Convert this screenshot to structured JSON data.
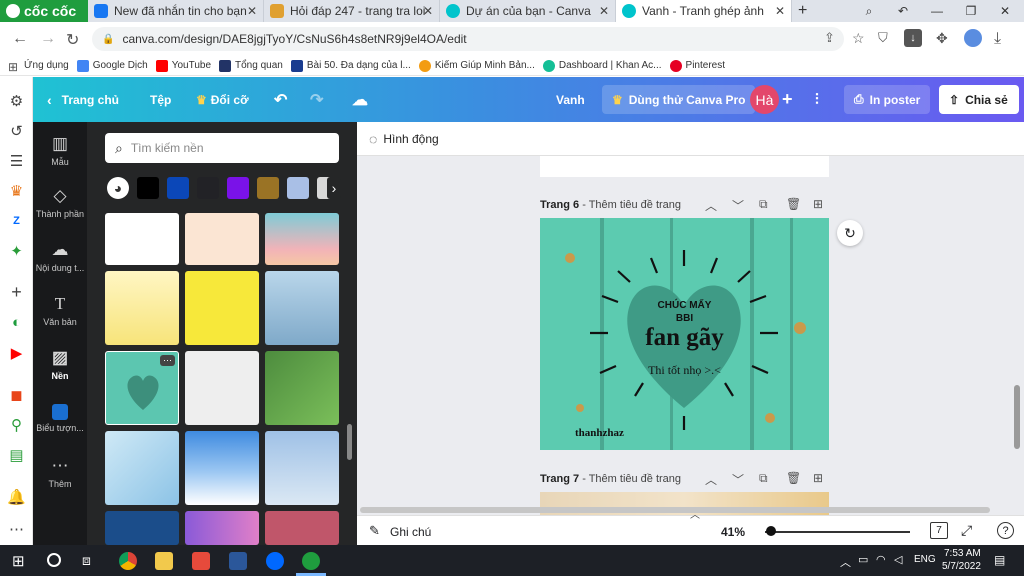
{
  "browser": {
    "logo_text": "cốc cốc",
    "tabs": [
      {
        "title": "New đã nhắn tin cho bạn",
        "color": "#1877f2"
      },
      {
        "title": "Hỏi đáp 247 - trang tra loi",
        "color": "#e0a030"
      },
      {
        "title": "Dự án của bạn - Canva",
        "color": "#00c4cc"
      },
      {
        "title": "Vanh - Tranh ghép ảnh",
        "color": "#00c4cc"
      }
    ],
    "new_tab": "+",
    "url": "canva.com/design/DAE8jgjTyoY/CsNuS6h4s8etNR9j9el4OA/edit",
    "bookmarks": [
      {
        "label": "Ứng dụng",
        "color": "#555555"
      },
      {
        "label": "Google Dịch",
        "color": "#4285f4"
      },
      {
        "label": "YouTube",
        "color": "#ff0000"
      },
      {
        "label": "Tổng quan",
        "color": "#223366"
      },
      {
        "label": "Bài 50. Đa dạng của l...",
        "color": "#1a3c8f"
      },
      {
        "label": "Kiếm Giúp Minh Bản...",
        "color": "#f39c12"
      },
      {
        "label": "Dashboard | Khan Ac...",
        "color": "#14bf96"
      },
      {
        "label": "Pinterest",
        "color": "#e60023"
      }
    ]
  },
  "topbar": {
    "home": "Trang chủ",
    "file": "Tệp",
    "resize": "Đổi cỡ",
    "title": "Vanh",
    "try_pro": "Dùng thử Canva Pro",
    "avatar": "Hà",
    "print": "In poster",
    "share": "Chia sẻ"
  },
  "sidenav": [
    {
      "label": "Mẫu",
      "icon": "template-icon"
    },
    {
      "label": "Thành phần",
      "icon": "elements-icon"
    },
    {
      "label": "Nội dung t...",
      "icon": "upload-icon"
    },
    {
      "label": "Văn bản",
      "icon": "text-icon"
    },
    {
      "label": "Nền",
      "icon": "background-icon"
    },
    {
      "label": "Biểu tượn...",
      "icon": "logo-icon"
    },
    {
      "label": "Thêm",
      "icon": "more-icon"
    }
  ],
  "panel": {
    "search_placeholder": "Tìm kiếm nền",
    "swatches": [
      "#000000",
      "#0b47b8",
      "#222226",
      "#7a12e8",
      "#9a7325",
      "#a9bfe6",
      "#d8d8d8"
    ]
  },
  "canvas": {
    "animate": "Hình động",
    "page6_num": "Trang 6",
    "page6_title": "- Thêm tiêu đề trang",
    "page7_num": "Trang 7",
    "page7_title": "- Thêm tiêu đề trang",
    "design": {
      "line1": "CHÚC MẤY",
      "line2": "BBI",
      "headline": "fan gãy",
      "sub": "Thi tốt nhọ >.<",
      "signature": "thanhzhaz"
    }
  },
  "bottombar": {
    "notes": "Ghi chú",
    "zoom": "41%",
    "zoom_fraction": 0.41,
    "page_count": "7"
  },
  "taskbar": {
    "lang": "ENG",
    "time": "7:53 AM",
    "date": "5/7/2022"
  }
}
